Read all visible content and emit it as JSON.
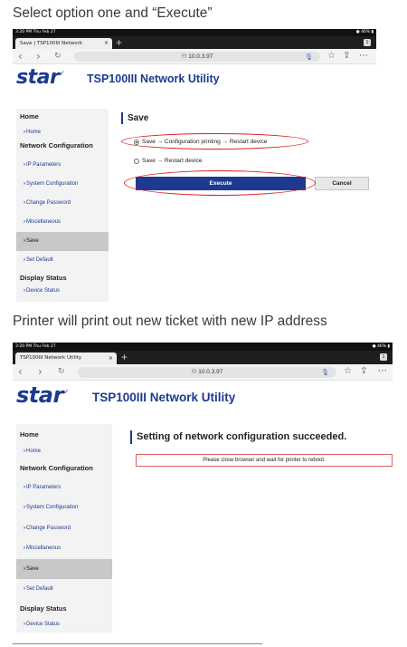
{
  "captions": {
    "step1": "Select option one and “Execute”",
    "step2": "Printer will print out new ticket with new IP address"
  },
  "browser": {
    "status_time": "3:20 PM  Thu Feb 27",
    "battery_1": "46%",
    "battery_2": "46%",
    "tab_title_1": "Save | TSP100III Network",
    "tab_title_2": "TSP100III Network Utility",
    "tab_close": "×",
    "tab_plus": "+",
    "tab_count": "1",
    "url": "10.0.3.97",
    "icons": [
      "lock-icon",
      "mic-icon",
      "star-icon",
      "share-icon",
      "more-icon"
    ]
  },
  "app": {
    "logo_text": "star",
    "logo_mark": "✓",
    "title": "TSP100III Network Utility",
    "brand_color": "#1d3a8f"
  },
  "sidebar": {
    "home_heading": "Home",
    "home_link": "Home",
    "netconf_heading": "Network Configuration",
    "items": [
      "IP Parameters",
      "System Configuration",
      "Change Password",
      "Miscellaneous",
      "Save",
      "Set Default"
    ],
    "display_heading": "Display Status",
    "device_status": "Device Status"
  },
  "save_page": {
    "heading": "Save",
    "option1": "Save → Configuration printing → Restart device",
    "option2": "Save → Restart device",
    "execute": "Execute",
    "cancel": "Cancel"
  },
  "result_page": {
    "heading": "Setting of network configuration succeeded.",
    "message": "Please close browser and wait for printer to reboot."
  }
}
